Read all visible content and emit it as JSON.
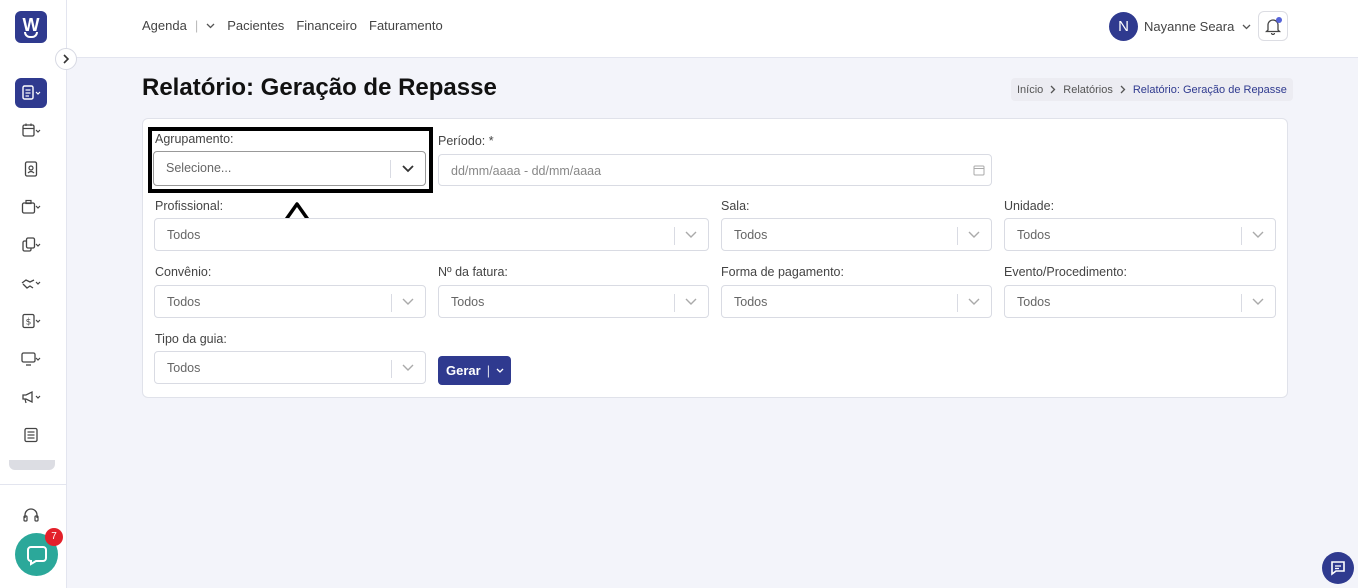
{
  "nav": {
    "items": [
      "Agenda",
      "Pacientes",
      "Financeiro",
      "Faturamento"
    ],
    "separator": "|"
  },
  "user": {
    "initial": "N",
    "name": "Nayanne Seara"
  },
  "page": {
    "title": "Relatório: Geração de Repasse"
  },
  "breadcrumb": [
    "Início",
    "Relatórios",
    "Relatório: Geração de Repasse"
  ],
  "filters": {
    "agrupamento": {
      "label": "Agrupamento:",
      "value": "Selecione..."
    },
    "periodo": {
      "label": "Período: *",
      "placeholder": "dd/mm/aaaa - dd/mm/aaaa"
    },
    "profissional": {
      "label": "Profissional:",
      "value": "Todos"
    },
    "sala": {
      "label": "Sala:",
      "value": "Todos"
    },
    "unidade": {
      "label": "Unidade:",
      "value": "Todos"
    },
    "convenio": {
      "label": "Convênio:",
      "value": "Todos"
    },
    "fatura": {
      "label": "Nº da fatura:",
      "value": "Todos"
    },
    "pagamento": {
      "label": "Forma de pagamento:",
      "value": "Todos"
    },
    "evento": {
      "label": "Evento/Procedimento:",
      "value": "Todos"
    },
    "tipo_guia": {
      "label": "Tipo da guia:",
      "value": "Todos"
    }
  },
  "actions": {
    "gerar_label": "Gerar",
    "gerar_sep": "|"
  },
  "chat": {
    "badge_count": "7"
  },
  "brand": {
    "logo_letter": "W",
    "accent": "#2f3a8f",
    "chat_color": "#2ba89a",
    "badge_color": "#e3202a"
  },
  "sidebar_icons": [
    "document-list-icon",
    "calendar-icon",
    "id-badge-icon",
    "briefcase-icon",
    "files-icon",
    "handshake-icon",
    "dollar-icon",
    "monitor-icon",
    "megaphone-icon",
    "newspaper-icon",
    "headset-icon"
  ]
}
